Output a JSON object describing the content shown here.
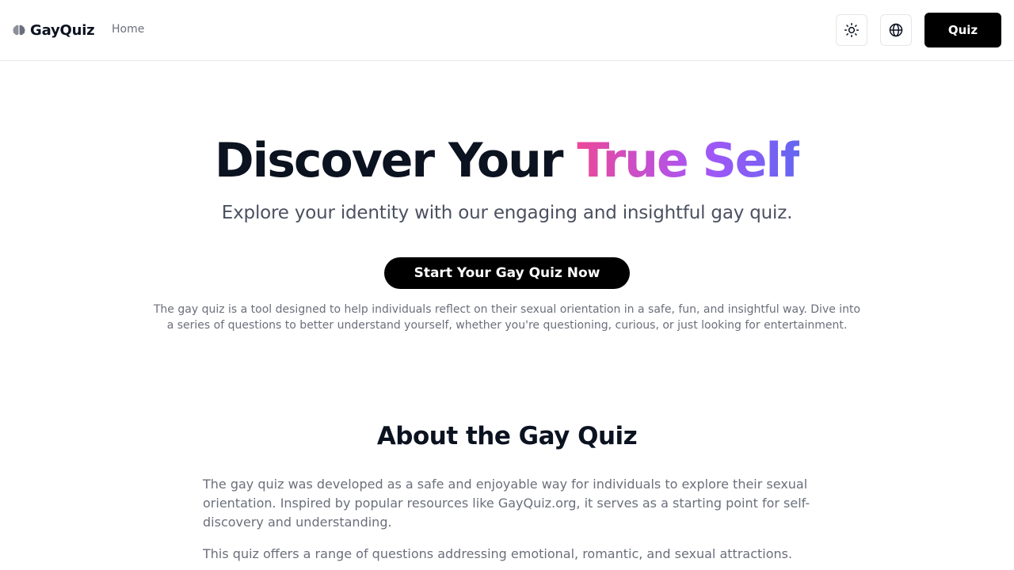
{
  "nav": {
    "brand": "GayQuiz",
    "home": "Home",
    "quiz_button": "Quiz"
  },
  "icons": {
    "brand": "brain-icon",
    "theme": "sun-icon",
    "language": "globe-icon"
  },
  "hero": {
    "title_plain": "Discover Your ",
    "title_highlight": "True Self",
    "subtitle": "Explore your identity with our engaging and insightful gay quiz.",
    "cta": "Start Your Gay Quiz Now",
    "description": "The gay quiz is a tool designed to help individuals reflect on their sexual orientation in a safe, fun, and insightful way. Dive into a series of questions to better understand yourself, whether you're questioning, curious, or just looking for entertainment."
  },
  "about": {
    "title": "About the Gay Quiz",
    "paragraphs": [
      "The gay quiz was developed as a safe and enjoyable way for individuals to explore their sexual orientation. Inspired by popular resources like GayQuiz.org, it serves as a starting point for self-discovery and understanding.",
      "This quiz offers a range of questions addressing emotional, romantic, and sexual attractions."
    ]
  },
  "colors": {
    "gradient_start": "#ec4899",
    "gradient_mid": "#a855f7",
    "gradient_end": "#6366f1",
    "button_bg": "#000000"
  }
}
